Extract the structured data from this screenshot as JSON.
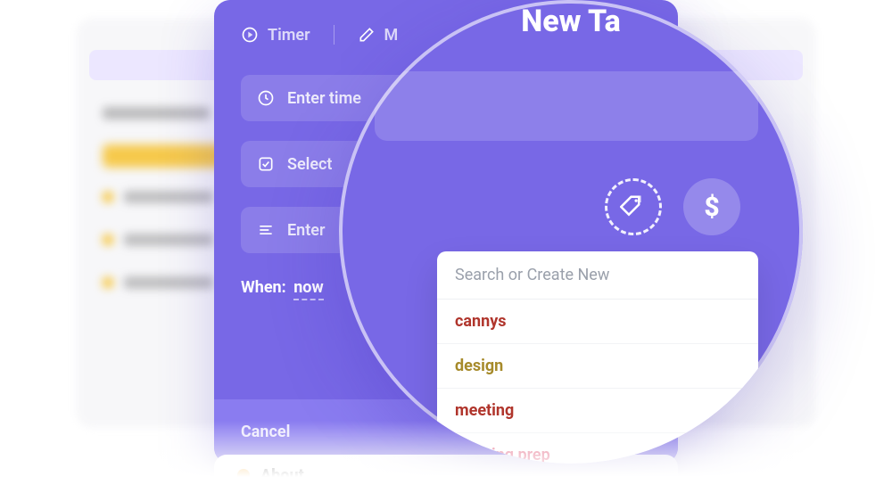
{
  "bg": {
    "about_label": "About"
  },
  "modal": {
    "tabs": {
      "timer": "Timer",
      "manual_abbrev": "M"
    },
    "title_partial": "New Ta",
    "fields": {
      "time_placeholder": "Enter time",
      "select_placeholder": "Select",
      "enter_placeholder": "Enter"
    },
    "when": {
      "label": "When:",
      "value": "now"
    },
    "footer": {
      "cancel": "Cancel"
    }
  },
  "lens": {
    "title_partial": "New Ta",
    "dollar_symbol": "$",
    "dropdown": {
      "search_placeholder": "Search or Create New",
      "items": [
        {
          "label": "cannys",
          "color": "c-red"
        },
        {
          "label": "design",
          "color": "c-olive"
        },
        {
          "label": "meeting",
          "color": "c-red"
        },
        {
          "label": "meeting prep",
          "color": "c-pink"
        }
      ]
    }
  }
}
